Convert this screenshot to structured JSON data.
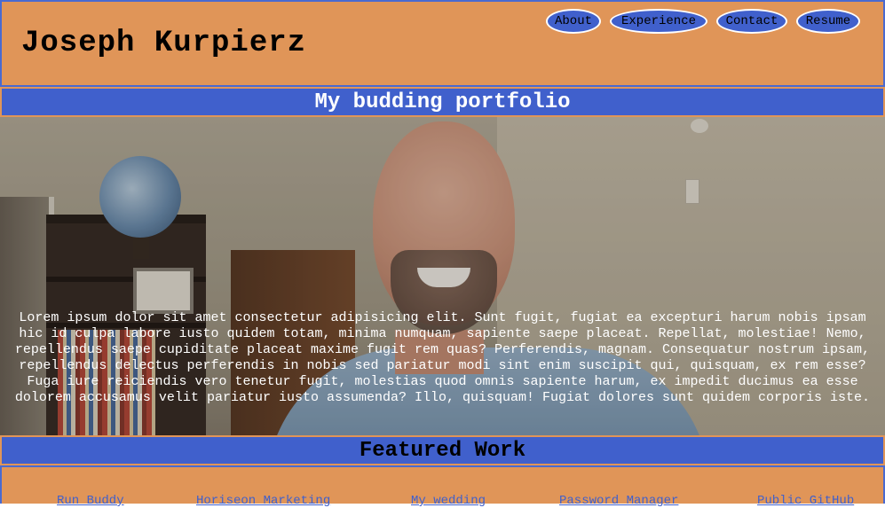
{
  "header": {
    "site_title": "Joseph Kurpierz",
    "nav": [
      "About",
      "Experience",
      "Contact",
      "Resume"
    ]
  },
  "tagline": "My budding portfolio",
  "hero": {
    "text": "Lorem ipsum dolor sit amet consectetur adipisicing elit. Sunt fugit, fugiat ea excepturi harum nobis ipsam hic id culpa labore iusto quidem totam, minima numquam, sapiente saepe placeat. Repellat, molestiae! Nemo, repellendus saepe cupiditate placeat maxime fugit rem quas? Perferendis, magnam. Consequatur nostrum ipsam, repellendus delectus perferendis in nobis sed pariatur modi sint enim suscipit qui, quisquam, ex rem esse? Fuga iure reiciendis vero tenetur fugit, molestias quod omnis sapiente harum, ex impedit ducimus ea esse dolorem accusamus velit pariatur iusto assumenda? Illo, quisquam! Fugiat dolores sunt quidem corporis iste."
  },
  "featured": {
    "heading": "Featured Work",
    "links": [
      "Run Buddy",
      "Horiseon Marketing",
      "My wedding",
      "Password Manager",
      "Public GitHub"
    ]
  },
  "colors": {
    "header_bg": "#e09558",
    "banner_bg": "#4060cc",
    "nav_bg": "#4060cc"
  }
}
